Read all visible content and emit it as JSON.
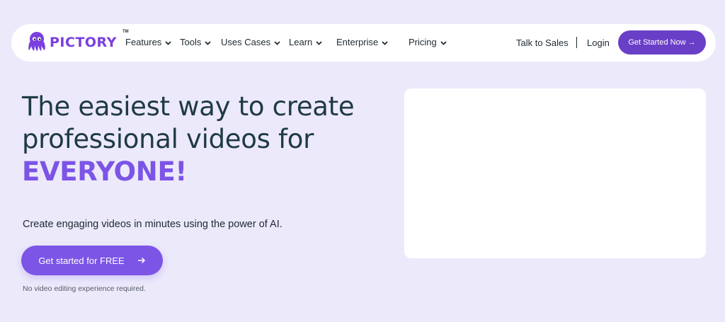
{
  "brand": {
    "name": "PICTORY",
    "trademark": "TM",
    "logo_icon": "octopus-icon",
    "color": "#7a3fe0"
  },
  "nav": {
    "items": [
      {
        "label": "Features",
        "icon": "chevron-down-icon"
      },
      {
        "label": "Tools",
        "icon": "chevron-down-icon"
      },
      {
        "label": "Uses Cases",
        "icon": "chevron-down-icon"
      },
      {
        "label": "Learn",
        "icon": "chevron-down-icon"
      },
      {
        "label": "Enterprise",
        "icon": "chevron-down-icon"
      },
      {
        "label": "Pricing",
        "icon": "chevron-down-icon"
      }
    ],
    "talk_to_sales": "Talk to Sales",
    "login": "Login",
    "cta": "Get Started Now →"
  },
  "hero": {
    "headline_line1": "The easiest way to create",
    "headline_line2": "professional videos for",
    "headline_accent": "EVERYONE!",
    "subtext": "Create engaging videos in minutes using the power of AI.",
    "cta_label": "Get started for FREE",
    "cta_icon": "arrow-right-icon",
    "note": "No video editing experience required."
  },
  "colors": {
    "background": "#ece9fb",
    "accent": "#7c54e6",
    "nav_cta": "#6a3fc7",
    "text": "#1f3a44"
  }
}
